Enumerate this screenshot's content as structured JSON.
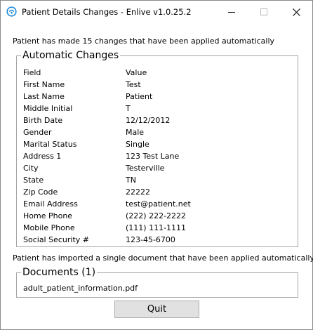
{
  "window": {
    "title": "Patient Details Changes - Enlive v1.0.25.2",
    "icon": "enlive-app-icon",
    "controls": {
      "minimize": "minimize-icon",
      "maximize": "maximize-icon",
      "close": "close-icon"
    }
  },
  "summary_text": "Patient has made 15 changes that have been applied automatically",
  "automatic_changes": {
    "title": "Automatic Changes",
    "header": {
      "field": "Field",
      "value": "Value"
    },
    "rows": [
      {
        "field": "First Name",
        "value": "Test"
      },
      {
        "field": "Last Name",
        "value": "Patient"
      },
      {
        "field": "Middle Initial",
        "value": "T"
      },
      {
        "field": "Birth Date",
        "value": "12/12/2012"
      },
      {
        "field": "Gender",
        "value": "Male"
      },
      {
        "field": "Marital Status",
        "value": "Single"
      },
      {
        "field": "Address 1",
        "value": "123 Test Lane"
      },
      {
        "field": "City",
        "value": "Testerville"
      },
      {
        "field": "State",
        "value": "TN"
      },
      {
        "field": "Zip Code",
        "value": "22222"
      },
      {
        "field": "Email Address",
        "value": "test@patient.net"
      },
      {
        "field": "Home Phone",
        "value": "(222) 222-2222"
      },
      {
        "field": "Mobile Phone",
        "value": "(111) 111-1111"
      },
      {
        "field": "Social Security #",
        "value": "123-45-6700"
      }
    ]
  },
  "import_text": "Patient has imported a single document that have been applied automatically",
  "documents": {
    "title": "Documents (1)",
    "items": [
      "adult_patient_information.pdf"
    ]
  },
  "buttons": {
    "quit": "Quit"
  },
  "colors": {
    "button_bg": "#e1e1e1",
    "border": "#a6a6a6",
    "icon_blue": "#1e88d6"
  }
}
